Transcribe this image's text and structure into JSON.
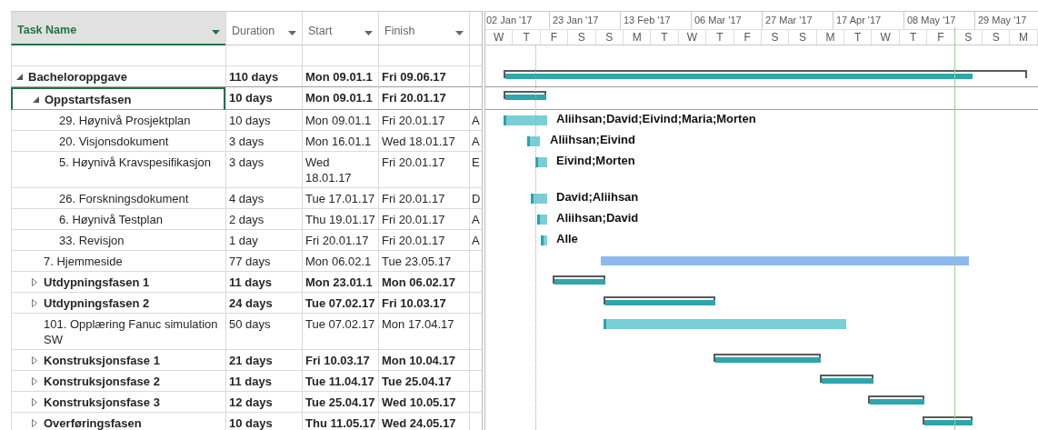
{
  "columns": [
    {
      "label": "Task Name",
      "selected": true
    },
    {
      "label": "Duration",
      "selected": false
    },
    {
      "label": "Start",
      "selected": false
    },
    {
      "label": "Finish",
      "selected": false
    }
  ],
  "timescale": {
    "major": [
      "02 Jan '17",
      "23 Jan '17",
      "13 Feb '17",
      "06 Mar '17",
      "27 Mar '17",
      "17 Apr '17",
      "08 May '17",
      "29 May '17"
    ],
    "minor": [
      "W",
      "T",
      "F",
      "S",
      "S",
      "M",
      "T",
      "W",
      "T",
      "F",
      "S",
      "S",
      "M",
      "T",
      "W",
      "T",
      "F",
      "S",
      "S",
      "M"
    ]
  },
  "tasks": [
    {
      "name": "Bacheloroppgave",
      "duration": "110 days",
      "start": "Mon 09.01.1",
      "finish": "Fri 09.06.17",
      "kind": "summary",
      "expanded": true,
      "selected": false,
      "children": [
        {
          "name": "Oppstartsfasen",
          "duration": "10 days",
          "start": "Mon 09.01.1",
          "finish": "Fri 20.01.17",
          "kind": "summary",
          "expanded": true,
          "selected": true,
          "children": [
            {
              "name": "29. Høynivå Prosjektplan",
              "duration": "10 days",
              "start": "Mon 09.01.1",
              "finish": "Fri 20.01.17",
              "column_5": "A",
              "resources": "Aliihsan;David;Eivind;Maria;Morten",
              "kind": "task",
              "selected": false
            },
            {
              "name": "20. Visjonsdokument",
              "duration": "3 days",
              "start": "Mon 16.01.1",
              "finish": "Wed 18.01.17",
              "column_5": "A",
              "resources": "Aliihsan;Eivind",
              "kind": "task",
              "selected": false
            },
            {
              "name": "5. Høynivå Kravspesifikasjon",
              "duration": "3 days",
              "start": "Wed 18.01.17",
              "finish": "Fri 20.01.17",
              "column_5": "E",
              "resources": "Eivind;Morten",
              "kind": "task",
              "selected": false
            },
            {
              "name": "26. Forskningsdokument",
              "duration": "4 days",
              "start": "Tue 17.01.17",
              "finish": "Fri 20.01.17",
              "column_5": "D",
              "resources": "David;Aliihsan",
              "kind": "task",
              "selected": false
            },
            {
              "name": "6. Høynivå Testplan",
              "duration": "2 days",
              "start": "Thu 19.01.17",
              "finish": "Fri 20.01.17",
              "column_5": "A",
              "resources": "Aliihsan;David",
              "kind": "task",
              "selected": false
            },
            {
              "name": "33. Revisjon",
              "duration": "1 day",
              "start": "Fri 20.01.17",
              "finish": "Fri 20.01.17",
              "column_5": "A",
              "resources": "Alle",
              "kind": "task",
              "selected": false
            }
          ]
        },
        {
          "name": "7. Hjemmeside",
          "duration": "77 days",
          "start": "Mon 06.02.1",
          "finish": "Tue 23.05.17",
          "kind": "task",
          "selected": false
        },
        {
          "name": "Utdypningsfasen 1",
          "duration": "11 days",
          "start": "Mon 23.01.1",
          "finish": "Mon 06.02.17",
          "kind": "summary",
          "expanded": false,
          "selected": false
        },
        {
          "name": "Utdypningsfasen 2",
          "duration": "24 days",
          "start": "Tue 07.02.17",
          "finish": "Fri 10.03.17",
          "kind": "summary",
          "expanded": false,
          "selected": false
        },
        {
          "name": "101. Opplæring Fanuc simulation SW",
          "duration": "50 days",
          "start": "Tue 07.02.17",
          "finish": "Mon 17.04.17",
          "kind": "task",
          "selected": false
        },
        {
          "name": "Konstruksjonsfase 1",
          "duration": "21 days",
          "start": "Fri 10.03.17",
          "finish": "Mon 10.04.17",
          "kind": "summary",
          "expanded": false,
          "selected": false
        },
        {
          "name": "Konstruksjonsfase 2",
          "duration": "11 days",
          "start": "Tue 11.04.17",
          "finish": "Tue 25.04.17",
          "kind": "summary",
          "expanded": false,
          "selected": false
        },
        {
          "name": "Konstruksjonsfase 3",
          "duration": "12 days",
          "start": "Tue 25.04.17",
          "finish": "Wed 10.05.17",
          "kind": "summary",
          "expanded": false,
          "selected": false
        },
        {
          "name": "Overføringsfasen",
          "duration": "10 days",
          "start": "Thu 11.05.17",
          "finish": "Wed 24.05.17",
          "kind": "summary",
          "expanded": false,
          "selected": false
        }
      ]
    }
  ]
}
